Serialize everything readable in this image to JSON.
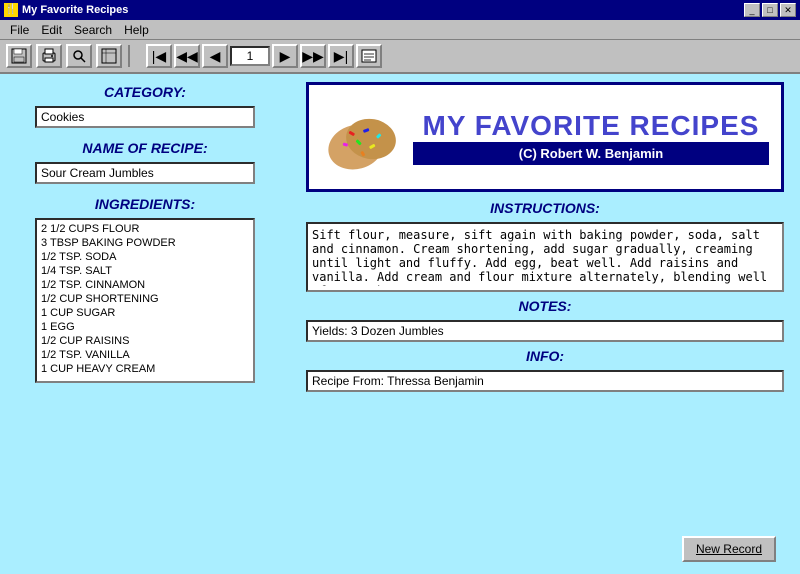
{
  "window": {
    "title": "My Favorite Recipes",
    "controls": [
      "_",
      "□",
      "✕"
    ]
  },
  "menu": {
    "items": [
      "File",
      "Edit",
      "Search",
      "Help"
    ]
  },
  "toolbar": {
    "buttons": [
      "💾",
      "🖨",
      "🔍",
      "📊"
    ],
    "nav_value": "1"
  },
  "left_panel": {
    "category_label": "CATEGORY:",
    "category_value": "Cookies",
    "recipe_name_label": "NAME OF RECIPE:",
    "recipe_name_value": "Sour Cream Jumbles",
    "ingredients_label": "INGREDIENTS:",
    "ingredients": [
      "2 1/2 CUPS FLOUR",
      "3 TBSP BAKING POWDER",
      "1/2 TSP. SODA",
      "1/4 TSP. SALT",
      "1/2 TSP. CINNAMON",
      "1/2 CUP SHORTENING",
      "1 CUP SUGAR",
      "1 EGG",
      "1/2 CUP RAISINS",
      "1/2 TSP. VANILLA",
      "1 CUP HEAVY CREAM"
    ]
  },
  "right_panel": {
    "recipe_title": "MY FAVORITE RECIPES",
    "copyright": "(C) Robert W. Benjamin",
    "instructions_label": "INSTRUCTIONS:",
    "instructions_text": "Sift flour, measure, sift again with baking powder, soda, salt and cinnamon. Cream shortening, add sugar gradually, creaming until light and fluffy. Add egg, beat well. Add raisins and vanilla. Add cream and flour mixture alternately, blending well after each",
    "notes_label": "NOTES:",
    "notes_value": "Yields: 3 Dozen Jumbles",
    "info_label": "INFO:",
    "info_value": "Recipe From: Thressa Benjamin"
  },
  "buttons": {
    "new_record": "New Record"
  },
  "icons": {
    "nav_first": "⏮",
    "nav_prev_prev": "⏪",
    "nav_prev": "◀",
    "nav_next": "▶",
    "nav_next_next": "⏩",
    "nav_last": "⏭",
    "nav_extra": "📋"
  }
}
